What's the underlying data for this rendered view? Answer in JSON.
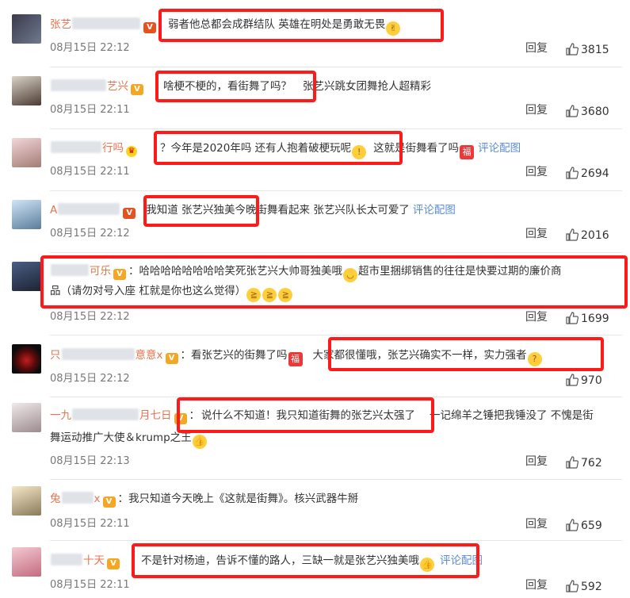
{
  "labels": {
    "reply": "回复"
  },
  "colors": {
    "username": "#eb7350",
    "link": "#5b8ed6",
    "highlight_box": "#ff1a1a"
  },
  "comments": [
    {
      "user_prefix": "张艺",
      "user_suffix": "",
      "text": "弱者他总都会成群结队 英雄在明处是勇敢无畏",
      "tail": "",
      "time": "08月15日 22:12",
      "likes": "3815",
      "emoji": "victory-hand-emoji"
    },
    {
      "user_prefix": "",
      "user_suffix": "艺兴",
      "text": "啥梗不梗的，看街舞了吗？",
      "tail": "张艺兴跳女团舞抢人超精彩",
      "time": "08月15日 22:11",
      "likes": "3680"
    },
    {
      "user_prefix": "",
      "user_suffix": "行吗",
      "text": "？今年是2020年吗 还有人抱着破梗玩呢",
      "tail": "这就是街舞看了吗",
      "link": "评论配图",
      "time": "08月15日 22:11",
      "likes": "2694"
    },
    {
      "user_prefix": "A",
      "user_suffix": "",
      "text": "我知道 张艺兴独美",
      "tail": "今晚街舞看起来 张艺兴队长太可爱了",
      "link": "评论配图",
      "time": "08月15日 22:12",
      "likes": "2016"
    },
    {
      "user_prefix": "",
      "user_suffix": "可乐",
      "text1": "：哈哈哈哈哈哈哈哈笑死张艺兴大帅哥独美哦",
      "text2": "超市里捆绑销售的往往是快要过期的廉价商",
      "text3": "品（请勿对号入座 杠就是你也这么觉得）",
      "time": "08月15日 22:12",
      "likes": "1699"
    },
    {
      "user_prefix": "只",
      "user_suffix": "意意x",
      "pre": "：看张艺兴的街舞了吗",
      "text": "大家都很懂哦，张艺兴确实不一样，实力强者",
      "time": "08月15日 22:12",
      "likes": "970"
    },
    {
      "user_prefix": "一九",
      "user_suffix": "月七日",
      "pre": "：",
      "text": "说什么不知道！我只知道街舞的张艺兴太强了",
      "tail": "一记绵羊之锤把我锤没了 不愧是街",
      "line2": "舞运动推广大使＆krump之王",
      "time": "08月15日 22:13",
      "likes": "762"
    },
    {
      "user_prefix": "兔",
      "user_suffix": "x",
      "text": "：我只知道今天晚上《这就是街舞》。核兴武器牛掰",
      "time": "08月15日 22:11",
      "likes": "659"
    },
    {
      "user_prefix": "",
      "user_suffix": "十天",
      "text": "不是针对杨迪，告诉不懂的路人，三缺一就是张艺兴独美哦",
      "link": "评论配图",
      "time": "08月15日 22:11",
      "likes": "592"
    }
  ]
}
